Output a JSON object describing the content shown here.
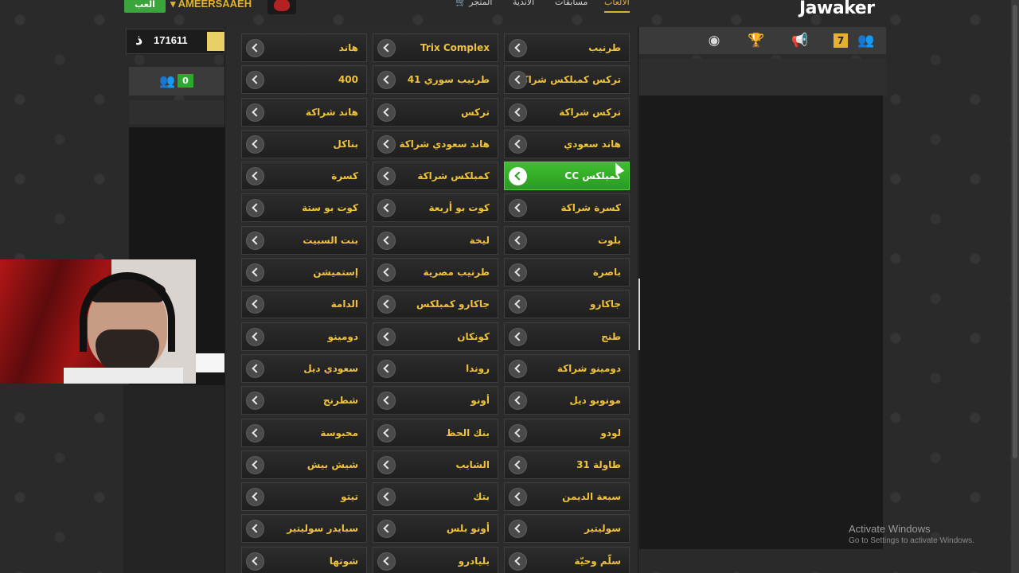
{
  "app": {
    "brand": "Jawaker",
    "play_label": "العب",
    "username": "AMEERSAAEH",
    "coins": "171611",
    "coin_symbol": "ذ",
    "online_friends": "0",
    "notifications": "7"
  },
  "nav": {
    "games": "الألعاب",
    "tournaments": "مسابقات",
    "clubs": "الأندية",
    "store": "المتجر"
  },
  "games": [
    {
      "label": "طرنيب",
      "active": false
    },
    {
      "label": "Trix Complex",
      "active": false
    },
    {
      "label": "هاند",
      "active": false
    },
    {
      "label": "تركس كمبلكس شراكة",
      "active": false
    },
    {
      "label": "طرنيب سوري 41",
      "active": false
    },
    {
      "label": "400",
      "active": false
    },
    {
      "label": "تركس شراكة",
      "active": false
    },
    {
      "label": "تركس",
      "active": false
    },
    {
      "label": "هاند شراكة",
      "active": false
    },
    {
      "label": "هاند سعودي",
      "active": false
    },
    {
      "label": "هاند سعودي شراكة",
      "active": false
    },
    {
      "label": "بناكل",
      "active": false
    },
    {
      "label": "كمبلكس CC",
      "active": true
    },
    {
      "label": "كمبلكس شراكة",
      "active": false
    },
    {
      "label": "كسرة",
      "active": false
    },
    {
      "label": "كسرة شراكة",
      "active": false
    },
    {
      "label": "كوت بو أربعة",
      "active": false
    },
    {
      "label": "كوت بو ستة",
      "active": false
    },
    {
      "label": "بلوت",
      "active": false
    },
    {
      "label": "ليخة",
      "active": false
    },
    {
      "label": "بنت السبيت",
      "active": false
    },
    {
      "label": "باصرة",
      "active": false
    },
    {
      "label": "طرنيب مصرية",
      "active": false
    },
    {
      "label": "إستميشن",
      "active": false
    },
    {
      "label": "جاكارو",
      "active": false
    },
    {
      "label": "جاكارو كمبلكس",
      "active": false
    },
    {
      "label": "الدامة",
      "active": false
    },
    {
      "label": "طنج",
      "active": false
    },
    {
      "label": "كونكان",
      "active": false
    },
    {
      "label": "دومينو",
      "active": false
    },
    {
      "label": "دومينو شراكة",
      "active": false
    },
    {
      "label": "روندا",
      "active": false
    },
    {
      "label": "سعودي ديل",
      "active": false
    },
    {
      "label": "مونوبو ديل",
      "active": false
    },
    {
      "label": "أونو",
      "active": false
    },
    {
      "label": "شطرنج",
      "active": false
    },
    {
      "label": "لودو",
      "active": false
    },
    {
      "label": "بنك الحظ",
      "active": false
    },
    {
      "label": "محبوسة",
      "active": false
    },
    {
      "label": "طاولة 31",
      "active": false
    },
    {
      "label": "الشايب",
      "active": false
    },
    {
      "label": "شيش بيش",
      "active": false
    },
    {
      "label": "سبعة الديمن",
      "active": false
    },
    {
      "label": "بتك",
      "active": false
    },
    {
      "label": "تيتو",
      "active": false
    },
    {
      "label": "سوليتير",
      "active": false
    },
    {
      "label": "أونو بلس",
      "active": false
    },
    {
      "label": "سبايدر سوليتير",
      "active": false
    },
    {
      "label": "سلّم وحيّة",
      "active": false
    },
    {
      "label": "بليادرو",
      "active": false
    },
    {
      "label": "شوتها",
      "active": false
    }
  ],
  "watermark": {
    "title": "Activate Windows",
    "subtitle": "Go to Settings to activate Windows."
  },
  "icons": [
    "rss-icon",
    "trophy-icon",
    "megaphone-icon",
    "users-icon",
    "coin-icon",
    "cart-icon"
  ]
}
